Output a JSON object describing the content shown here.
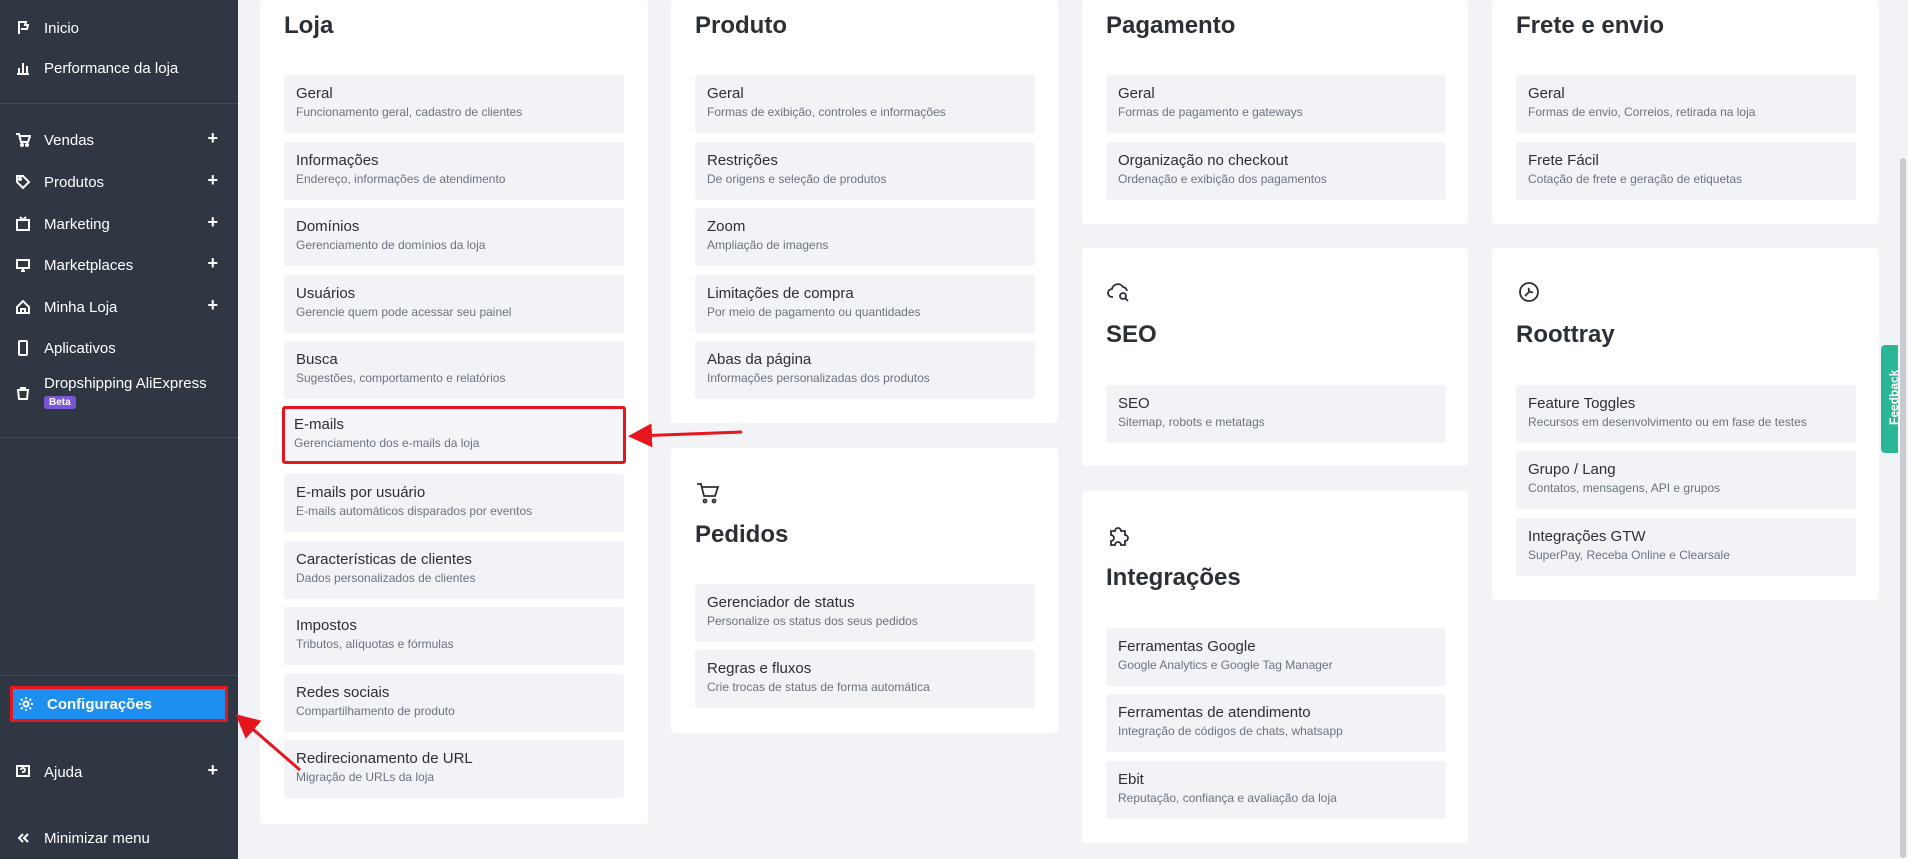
{
  "sidebar": {
    "items": [
      {
        "label": "Inicio",
        "icon": "flag-icon"
      },
      {
        "label": "Performance da loja",
        "icon": "bar-chart-icon"
      },
      {
        "label": "Vendas",
        "icon": "cart-icon"
      },
      {
        "label": "Produtos",
        "icon": "tag-icon"
      },
      {
        "label": "Marketing",
        "icon": "tv-icon"
      },
      {
        "label": "Marketplaces",
        "icon": "monitor-icon"
      },
      {
        "label": "Minha Loja",
        "icon": "home-icon"
      },
      {
        "label": "Aplicativos",
        "icon": "phone-icon"
      },
      {
        "label": "Dropshipping AliExpress",
        "icon": "bag-icon",
        "badge": "Beta"
      },
      {
        "label": "Configurações",
        "icon": "gear-icon"
      },
      {
        "label": "Ajuda",
        "icon": "help-icon"
      },
      {
        "label": "Minimizar menu",
        "icon": "double-chevron-left-icon"
      }
    ],
    "active_color": "#1d8ff0"
  },
  "loja": {
    "title": "Loja",
    "items": [
      {
        "title": "Geral",
        "desc": "Funcionamento geral, cadastro de clientes"
      },
      {
        "title": "Informações",
        "desc": "Endereço, informações de atendimento"
      },
      {
        "title": "Domínios",
        "desc": "Gerenciamento de domínios da loja"
      },
      {
        "title": "Usuários",
        "desc": "Gerencie quem pode acessar seu painel"
      },
      {
        "title": "Busca",
        "desc": "Sugestões, comportamento e relatórios"
      },
      {
        "title": "E-mails",
        "desc": "Gerenciamento dos e-mails da loja"
      },
      {
        "title": "E-mails por usuário",
        "desc": "E-mails automáticos disparados por eventos"
      },
      {
        "title": "Características de clientes",
        "desc": "Dados personalizados de clientes"
      },
      {
        "title": "Impostos",
        "desc": "Tributos, alíquotas e fórmulas"
      },
      {
        "title": "Redes sociais",
        "desc": "Compartilhamento de produto"
      },
      {
        "title": "Redirecionamento de URL",
        "desc": "Migração de URLs da loja"
      }
    ]
  },
  "produto": {
    "title": "Produto",
    "items": [
      {
        "title": "Geral",
        "desc": "Formas de exibição, controles e informações"
      },
      {
        "title": "Restrições",
        "desc": "De origens e seleção de produtos"
      },
      {
        "title": "Zoom",
        "desc": "Ampliação de imagens"
      },
      {
        "title": "Limitações de compra",
        "desc": "Por meio de pagamento ou quantidades"
      },
      {
        "title": "Abas da página",
        "desc": "Informações personalizadas dos produtos"
      }
    ]
  },
  "pedidos": {
    "title": "Pedidos",
    "items": [
      {
        "title": "Gerenciador de status",
        "desc": "Personalize os status dos seus pedidos"
      },
      {
        "title": "Regras e fluxos",
        "desc": "Crie trocas de status de forma automática"
      }
    ]
  },
  "pagamento": {
    "title": "Pagamento",
    "items": [
      {
        "title": "Geral",
        "desc": "Formas de pagamento e gateways"
      },
      {
        "title": "Organização no checkout",
        "desc": "Ordenação e exibição dos pagamentos"
      }
    ]
  },
  "seo": {
    "title": "SEO",
    "items": [
      {
        "title": "SEO",
        "desc": "Sitemap, robots e metatags"
      }
    ]
  },
  "integracoes": {
    "title": "Integrações",
    "items": [
      {
        "title": "Ferramentas Google",
        "desc": "Google Analytics e Google Tag Manager"
      },
      {
        "title": "Ferramentas de atendimento",
        "desc": "Integração de códigos de chats, whatsapp"
      },
      {
        "title": "Ebit",
        "desc": "Reputação, confiança e avaliação da loja"
      }
    ]
  },
  "frete": {
    "title": "Frete e envio",
    "items": [
      {
        "title": "Geral",
        "desc": "Formas de envio, Correios, retirada na loja"
      },
      {
        "title": "Frete Fácil",
        "desc": "Cotação de frete e geração de etiquetas"
      }
    ]
  },
  "roottray": {
    "title": "Roottray",
    "items": [
      {
        "title": "Feature Toggles",
        "desc": "Recursos em desenvolvimento ou em fase de testes"
      },
      {
        "title": "Grupo / Lang",
        "desc": "Contatos, mensagens, API e grupos"
      },
      {
        "title": "Integrações GTW",
        "desc": "SuperPay, Receba Online e Clearsale"
      }
    ]
  },
  "feedback": {
    "label": "Feedback"
  },
  "colors": {
    "highlight": "#e5161d",
    "feedback": "#2bb795"
  }
}
